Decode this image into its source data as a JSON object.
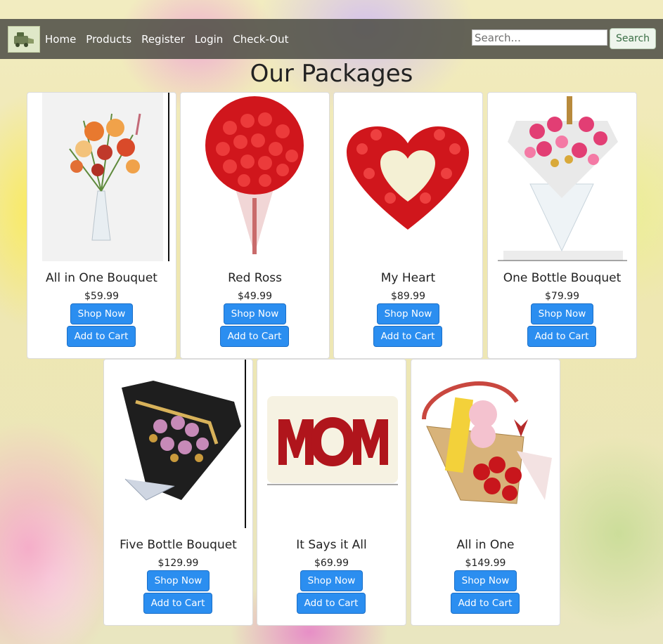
{
  "nav": {
    "links": [
      "Home",
      "Products",
      "Register",
      "Login",
      "Check-Out"
    ],
    "search_placeholder": "Search...",
    "search_button": "Search"
  },
  "page_title": "Our Packages",
  "buttons": {
    "shop_now": "Shop Now",
    "add_to_cart": "Add to Cart"
  },
  "products": [
    {
      "name": "All in One Bouquet",
      "price": "$59.99",
      "image": "mixed-flower-vase"
    },
    {
      "name": "Red Ross",
      "price": "$49.99",
      "image": "red-rose-bouquet"
    },
    {
      "name": "My Heart",
      "price": "$89.99",
      "image": "heart-rose-arrangement"
    },
    {
      "name": "One Bottle Bouquet",
      "price": "$79.99",
      "image": "bottle-bouquet-pink"
    },
    {
      "name": "Five Bottle Bouquet",
      "price": "$129.99",
      "image": "five-bottle-bouquet"
    },
    {
      "name": "It Says it All",
      "price": "$69.99",
      "image": "mom-flower-letters"
    },
    {
      "name": "All in One",
      "price": "$149.99",
      "image": "gift-basket"
    }
  ],
  "colors": {
    "primary_button": "#2b8ef0",
    "navbar": "#505048",
    "search_button_text": "#3a6e45"
  }
}
